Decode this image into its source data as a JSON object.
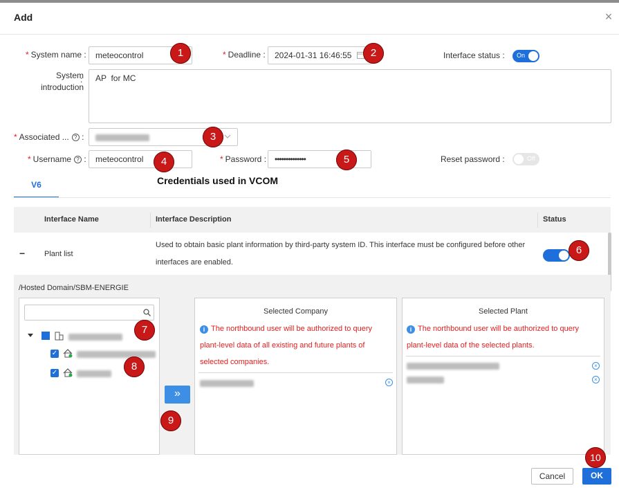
{
  "dialog": {
    "title": "Add",
    "close_glyph": "×"
  },
  "form": {
    "system_name": {
      "label": "System name",
      "value": "meteocontrol"
    },
    "deadline": {
      "label": "Deadline",
      "value": "2024-01-31 16:46:55"
    },
    "interface_status": {
      "label": "Interface status",
      "toggle_text": "On"
    },
    "system_introduction": {
      "label_line1": "System",
      "label_line2": "introduction",
      "value": "AP  for MC"
    },
    "associated": {
      "label": "Associated ..."
    },
    "username": {
      "label": "Username",
      "value": "meteocontrol"
    },
    "password": {
      "label": "Password",
      "value": "••••••••••••••"
    },
    "reset_password": {
      "label": "Reset password",
      "toggle_text": "Off"
    },
    "colon": ":",
    "required_mark": "*",
    "help_glyph": "?"
  },
  "tabs": [
    {
      "label": "V6"
    }
  ],
  "annotation_heading": "Credentials used in VCOM",
  "table": {
    "headers": [
      "Interface Name",
      "Interface Description",
      "Status"
    ],
    "rows": [
      {
        "expand_glyph": "−",
        "name": "Plant list",
        "description_line1": "Used to obtain basic plant information by third-party system ID. This interface must be configured before other",
        "description_line2": "interfaces are enabled."
      }
    ]
  },
  "domain_path": "/Hosted Domain/SBM-ENERGIE",
  "selected_company": {
    "title": "Selected Company",
    "warning_line1": "The northbound user will be authorized to query",
    "warning_line2": "plant-level data of all existing and future plants of",
    "warning_line3": "selected companies."
  },
  "selected_plant": {
    "title": "Selected Plant",
    "warning_line1": "The northbound user will be authorized to query",
    "warning_line2": "plant-level data of the selected plants."
  },
  "transfer_glyph": "»",
  "info_glyph": "i",
  "remove_glyph": "×",
  "check_glyph": "✓",
  "badges": [
    "1",
    "2",
    "3",
    "4",
    "5",
    "6",
    "7",
    "8",
    "9",
    "10"
  ],
  "footer": {
    "cancel_label": "Cancel",
    "ok_label": "OK"
  },
  "colors": {
    "primary": "#1e6fd9",
    "badge": "#c81818",
    "warning": "#e02020"
  }
}
